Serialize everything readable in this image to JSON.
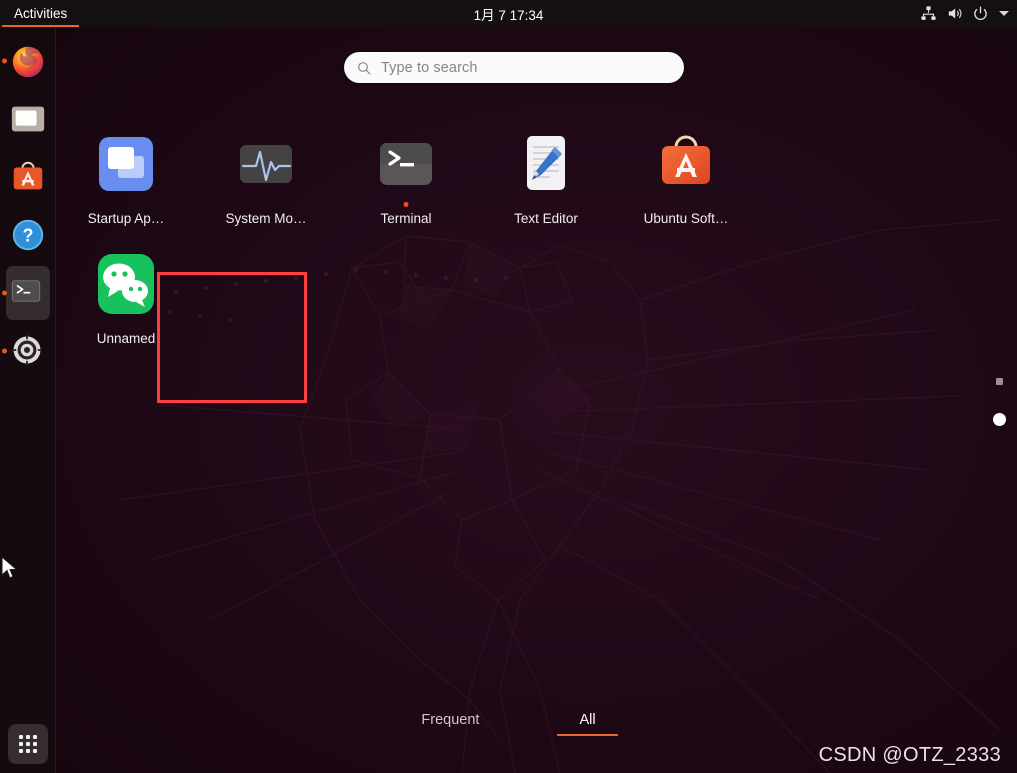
{
  "topbar": {
    "activities_label": "Activities",
    "clock": "1月 7 17:34",
    "tray": {
      "network_icon": "network-wired-icon",
      "volume_icon": "volume-icon",
      "power_icon": "power-icon",
      "menu_icon": "chevron-down-icon"
    }
  },
  "dock": {
    "items": [
      {
        "name": "firefox",
        "label": "Firefox",
        "running": true,
        "focused": false
      },
      {
        "name": "files",
        "label": "Files",
        "running": false,
        "focused": false
      },
      {
        "name": "ubuntu-software",
        "label": "Ubuntu Software",
        "running": false,
        "focused": false
      },
      {
        "name": "help",
        "label": "Help",
        "running": false,
        "focused": false
      },
      {
        "name": "terminal",
        "label": "Terminal",
        "running": true,
        "focused": true
      },
      {
        "name": "settings",
        "label": "Settings",
        "running": true,
        "focused": false
      }
    ],
    "show_apps_label": "Show Applications"
  },
  "search": {
    "placeholder": "Type to search",
    "value": "",
    "icon": "search-icon"
  },
  "apps": [
    {
      "name": "startup-applications",
      "label": "Startup Ap…",
      "running": false
    },
    {
      "name": "system-monitor",
      "label": "System Mo…",
      "running": false
    },
    {
      "name": "terminal",
      "label": "Terminal",
      "running": true
    },
    {
      "name": "text-editor",
      "label": "Text Editor",
      "running": false
    },
    {
      "name": "ubuntu-software",
      "label": "Ubuntu Soft…",
      "running": false
    },
    {
      "name": "wechat-unnamed",
      "label": "Unnamed",
      "running": false
    }
  ],
  "highlight": {
    "target_label": "Unnamed",
    "color": "#fb4040"
  },
  "page_indicator": {
    "pages": 2,
    "current": 2
  },
  "tabs": [
    {
      "name": "frequent",
      "label": "Frequent",
      "selected": false
    },
    {
      "name": "all",
      "label": "All",
      "selected": true
    }
  ],
  "watermark": "CSDN @OTZ_2333",
  "colors": {
    "accent": "#e8662b",
    "highlight": "#fb4040",
    "topbar_bg": "#141011",
    "wechat_green": "#1aad4b"
  }
}
